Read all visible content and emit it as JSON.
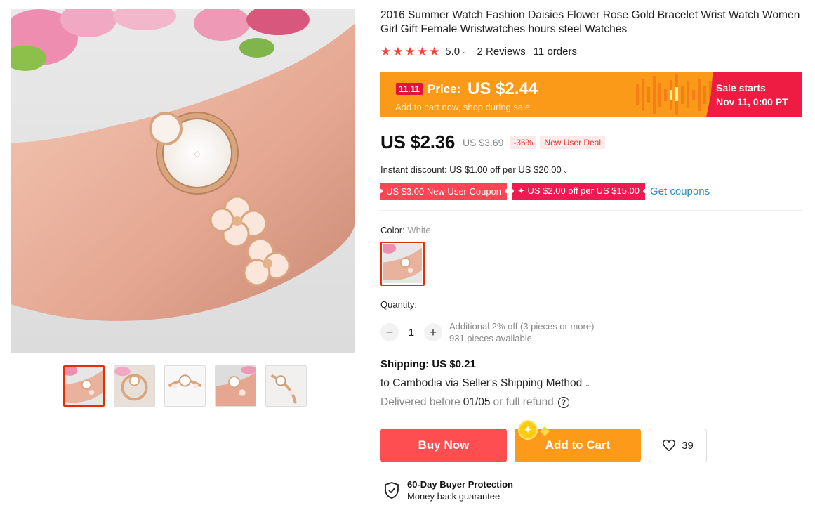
{
  "product": {
    "title": "2016 Summer Watch Fashion Daisies Flower Rose Gold Bracelet Wrist Watch Women Girl Gift Female Wristwatches hours steel Watches",
    "rating": "5.0",
    "reviews": "2 Reviews",
    "orders": "11 orders",
    "star_color": "#f44336"
  },
  "promo": {
    "badge": "11.11",
    "price_label": "Price:",
    "price": "US $2.44",
    "subtitle": "Add to cart now, shop during sale",
    "sale_line1": "Sale starts",
    "sale_line2": "Nov 11, 0:00 PT",
    "bg_color": "#fa9a18",
    "accent_color": "#ee1c42"
  },
  "price": {
    "current": "US $2.36",
    "original": "US $3.69",
    "discount": "-36%",
    "deal": "New User Deal"
  },
  "instant_discount": "Instant discount: US $1.00 off per US $20.00",
  "coupons": {
    "items": [
      "US $3.00 New User Coupon",
      "✦ US $2.00 off per US $15.00"
    ],
    "get_label": "Get coupons"
  },
  "color": {
    "label": "Color:",
    "value": "White"
  },
  "quantity": {
    "label": "Quantity:",
    "value": "1",
    "minus": "−",
    "plus": "+",
    "note1": "Additional 2% off (3 pieces or more)",
    "note2": "931 pieces available"
  },
  "shipping": {
    "title": "Shipping: US $0.21",
    "route": "to Cambodia via Seller's Shipping Method",
    "delivery_prefix": "Delivered before",
    "delivery_date": "01/05",
    "delivery_suffix": "or full refund",
    "help": "?"
  },
  "actions": {
    "buy_now": "Buy Now",
    "add_to_cart": "Add to Cart",
    "wish_count": "39",
    "buy_color": "#fe4e52",
    "cart_color": "#fe9a1a"
  },
  "protection": {
    "title": "60-Day Buyer Protection",
    "subtitle": "Money back guarantee"
  },
  "gallery": {
    "thumbnails": [
      "thumb-1",
      "thumb-2",
      "thumb-3",
      "thumb-4",
      "thumb-5"
    ],
    "active_index": 0
  }
}
